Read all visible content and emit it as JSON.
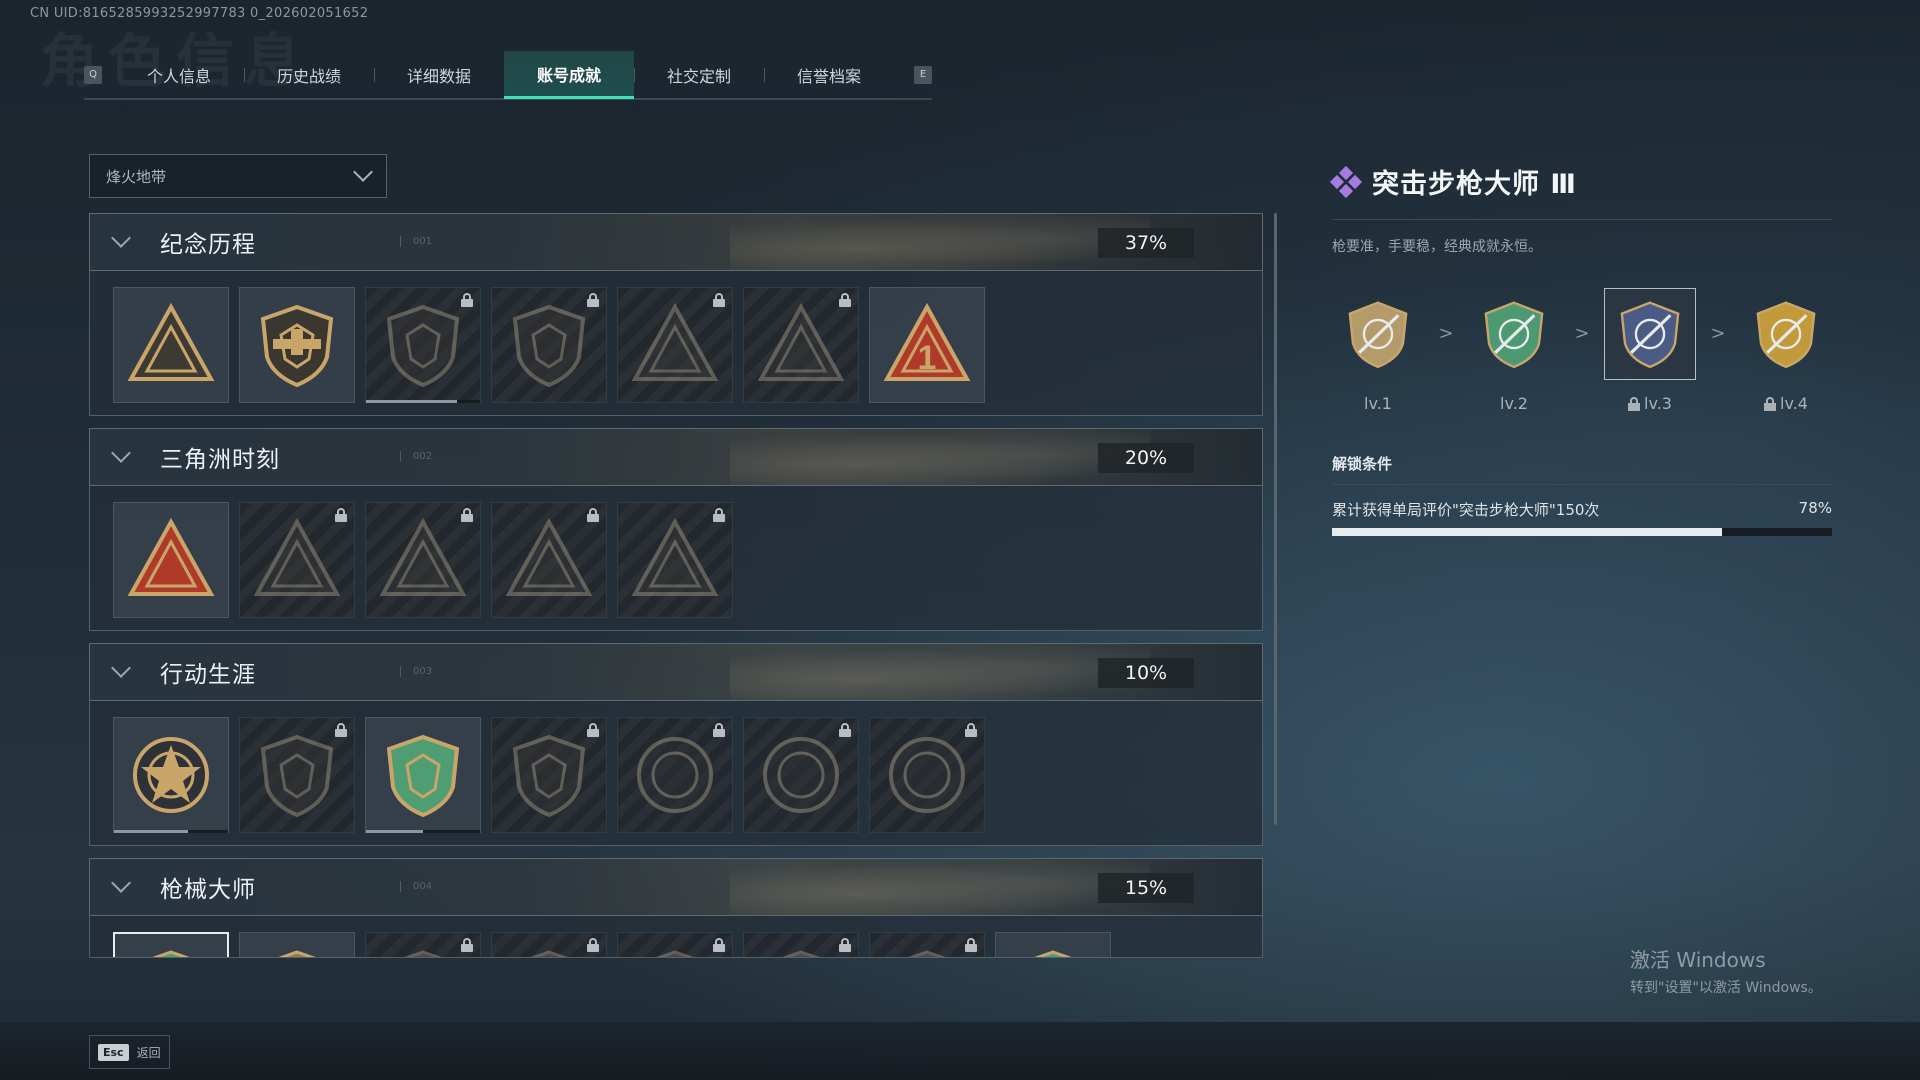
{
  "uid_text": "CN UID:8165285993252997783 0_202602051652",
  "ghost_title": "角色信息",
  "tabs": {
    "left_key": "Q",
    "right_key": "E",
    "items": [
      {
        "label": "个人信息"
      },
      {
        "label": "历史战绩"
      },
      {
        "label": "详细数据"
      },
      {
        "label": "账号成就"
      },
      {
        "label": "社交定制"
      },
      {
        "label": "信誉档案"
      }
    ],
    "active_index": 3
  },
  "mode_select": {
    "value": "烽火地带"
  },
  "sections": [
    {
      "title": "纪念历程",
      "num": "001",
      "percent": "37%",
      "medals": [
        {
          "icon": "triangle-badge-icon",
          "locked": false,
          "progress": null
        },
        {
          "icon": "helicopter-badge-icon",
          "locked": false,
          "progress": null
        },
        {
          "icon": "crest-badge-icon",
          "locked": true,
          "progress": 0.8
        },
        {
          "icon": "number-58-badge-icon",
          "locked": true,
          "progress": null
        },
        {
          "icon": "soldier-triangle-badge-icon",
          "locked": true,
          "progress": null
        },
        {
          "icon": "skull-triangle-badge-icon",
          "locked": true,
          "progress": null
        },
        {
          "icon": "number-1-triangle-badge-icon",
          "locked": false,
          "progress": null
        }
      ]
    },
    {
      "title": "三角洲时刻",
      "num": "002",
      "percent": "20%",
      "medals": [
        {
          "icon": "robot-triangle-badge-icon",
          "locked": false,
          "progress": null
        },
        {
          "icon": "knight-triangle-badge-icon",
          "locked": true,
          "progress": null
        },
        {
          "icon": "bear-triangle-badge-icon",
          "locked": true,
          "progress": null
        },
        {
          "icon": "wreath-triangle-badge-icon",
          "locked": true,
          "progress": null
        },
        {
          "icon": "team-triangle-badge-icon",
          "locked": true,
          "progress": null
        }
      ]
    },
    {
      "title": "行动生涯",
      "num": "003",
      "percent": "10%",
      "medals": [
        {
          "icon": "star-round-badge-icon",
          "locked": false,
          "progress": 0.65
        },
        {
          "icon": "fire-shield-badge-icon",
          "locked": true,
          "progress": null
        },
        {
          "icon": "green-shield-badge-icon",
          "locked": false,
          "progress": 0.5
        },
        {
          "icon": "hex-shield-badge-icon",
          "locked": true,
          "progress": null
        },
        {
          "icon": "ring-badge-icon",
          "locked": true,
          "progress": null
        },
        {
          "icon": "skull-round-badge-icon",
          "locked": true,
          "progress": null
        },
        {
          "icon": "eye-round-badge-icon",
          "locked": true,
          "progress": null
        }
      ]
    },
    {
      "title": "枪械大师",
      "num": "004",
      "percent": "15%",
      "medals": [
        {
          "icon": "rifle-shield-badge-icon",
          "locked": false,
          "selected": true
        },
        {
          "icon": "rifle-badge-icon",
          "locked": false
        },
        {
          "icon": "rifle-badge-icon",
          "locked": true
        },
        {
          "icon": "rifle-badge-icon",
          "locked": true
        },
        {
          "icon": "rifle-badge-icon",
          "locked": true
        },
        {
          "icon": "rifle-badge-icon",
          "locked": true
        },
        {
          "icon": "rifle-badge-icon",
          "locked": true
        },
        {
          "icon": "rifle-shield-badge-icon",
          "locked": false
        }
      ]
    }
  ],
  "detail": {
    "name": "突击步枪大师 Ⅲ",
    "description": "枪要准，手要稳，经典成就永恒。",
    "levels": [
      {
        "label": "lv.1",
        "locked": false,
        "color": "#b59a6a"
      },
      {
        "label": "lv.2",
        "locked": false,
        "color": "#4d9a72"
      },
      {
        "label": "lv.3",
        "locked": true,
        "color": "#4a5c86",
        "current": true
      },
      {
        "label": "lv.4",
        "locked": true,
        "color": "#c29a3a"
      }
    ],
    "arrow": ">",
    "unlock_title": "解锁条件",
    "condition_text": "累计获得单局评价\"突击步枪大师\"150次",
    "condition_percent": "78%",
    "condition_progress": 0.78
  },
  "footer": {
    "esc_key": "Esc",
    "esc_label": "返回"
  },
  "watermark": {
    "line1": "激活 Windows",
    "line2": "转到\"设置\"以激活 Windows。"
  }
}
